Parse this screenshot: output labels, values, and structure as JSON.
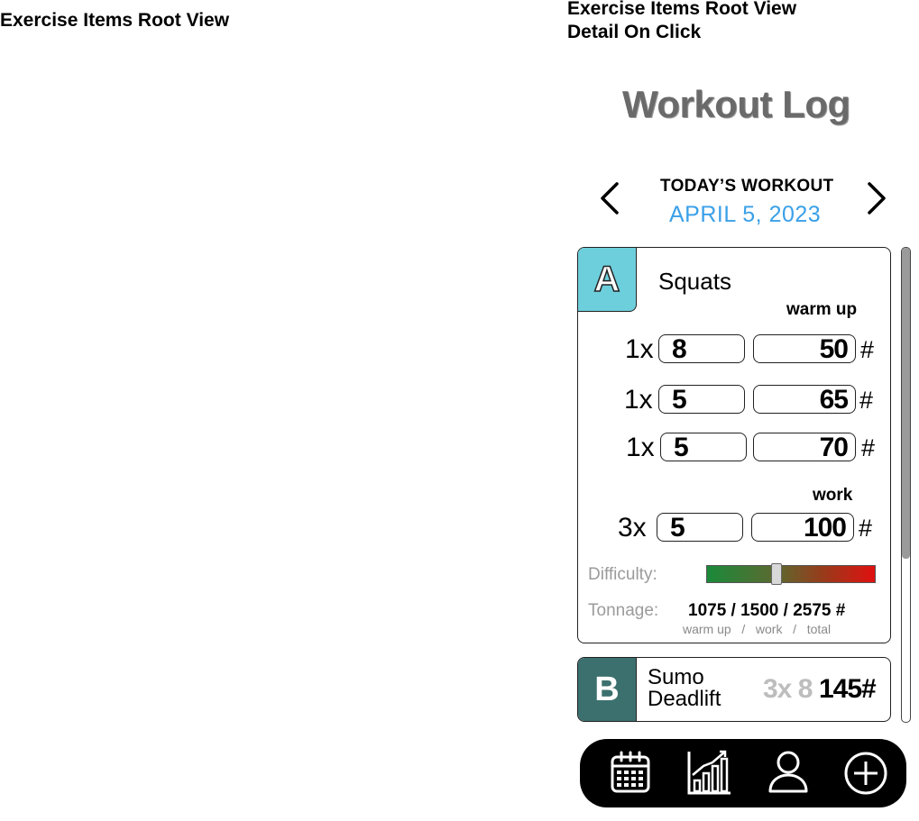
{
  "frames": {
    "left_title": "Exercise Items Root View",
    "right_title_line1": "Exercise Items Root View",
    "right_title_line2": "Detail On Click"
  },
  "app": {
    "title": "Workout Log"
  },
  "header": {
    "prev_icon": "chevron-left-icon",
    "next_icon": "chevron-right-icon",
    "prev_glyph": "<",
    "next_glyph": ">",
    "today_label": "TODAY’S WORKOUT",
    "date": "APRIL 5, 2023",
    "date_color": "#3aa0e8"
  },
  "exercise_a": {
    "letter": "A",
    "name": "Squats",
    "badge_color": "#6dcfdc",
    "warmup_label": "warm up",
    "work_label": "work",
    "warmup_sets": [
      {
        "mult": "1x",
        "reps": "8",
        "weight": "50",
        "unit": "#"
      },
      {
        "mult": "1x",
        "reps": "5",
        "weight": "65",
        "unit": "#"
      },
      {
        "mult": "1x",
        "reps": "5",
        "weight": "70",
        "unit": "#"
      }
    ],
    "work_sets": [
      {
        "mult": "3x",
        "reps": "5",
        "weight": "100",
        "unit": "#"
      }
    ],
    "difficulty_label": "Difficulty:",
    "difficulty_level": 0.41,
    "tonnage_label": "Tonnage:",
    "tonnage_values": "1075 / 1500 / 2575  #",
    "tonnage_legend": "warm up   /   work   /   total"
  },
  "exercise_b": {
    "letter": "B",
    "name_line1": "Sumo",
    "name_line2": "Deadlift",
    "badge_color": "#3b706e",
    "sets_reps": "3x 8",
    "weight": "145#"
  },
  "bottom_nav": {
    "icons": [
      "calendar-icon",
      "chart-icon",
      "profile-icon",
      "add-icon"
    ]
  }
}
